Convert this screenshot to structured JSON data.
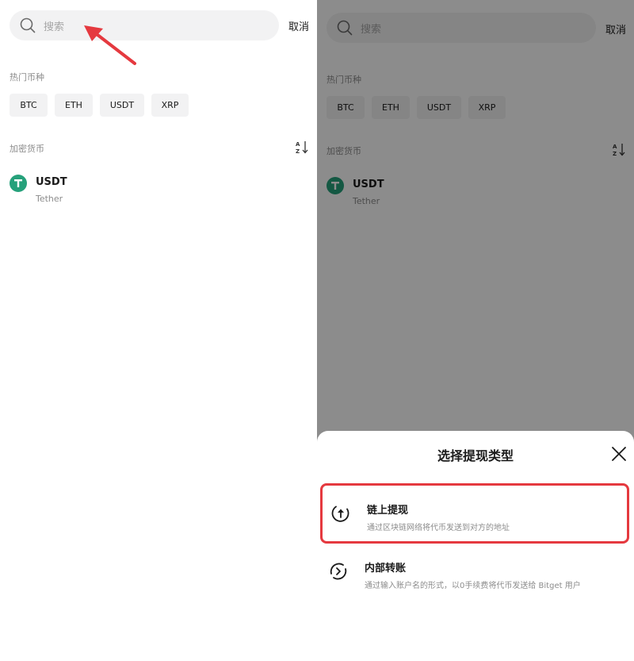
{
  "search": {
    "placeholder": "搜索",
    "cancel_label": "取消"
  },
  "hot_section": {
    "label": "热门币种",
    "chips": [
      "BTC",
      "ETH",
      "USDT",
      "XRP"
    ]
  },
  "crypto_section": {
    "label": "加密货币",
    "sort_icon": "az-sort-icon"
  },
  "coins": [
    {
      "symbol": "USDT",
      "name": "Tether",
      "logo_letter": "T",
      "logo_color": "#26a17b"
    }
  ],
  "withdraw_sheet": {
    "title": "选择提现类型",
    "options": [
      {
        "title": "链上提现",
        "description": "通过区块链网络将代币发送到对方的地址",
        "icon": "upload-circle-icon",
        "highlighted": true
      },
      {
        "title": "内部转账",
        "description": "通过输入账户名的形式，以0手续费将代币发送给 Bitget 用户",
        "icon": "transfer-circle-icon",
        "highlighted": false
      }
    ]
  },
  "colors": {
    "accent_red": "#e5393f",
    "tether_green": "#26a17b",
    "chip_bg": "#f2f2f3"
  }
}
